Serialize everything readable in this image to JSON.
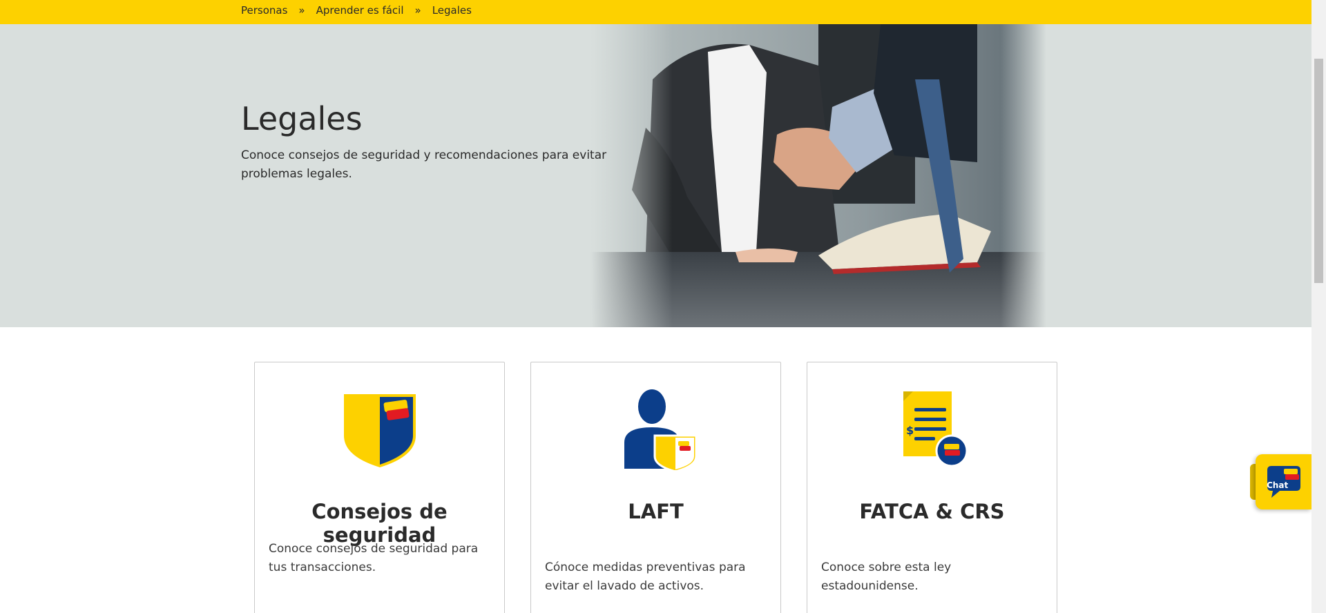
{
  "breadcrumb": {
    "items": [
      "Personas",
      "Aprender es fácil",
      "Legales"
    ],
    "separator": "»"
  },
  "hero": {
    "title": "Legales",
    "description": "Conoce consejos de seguridad y recomendaciones para evitar problemas legales."
  },
  "cards": [
    {
      "icon": "shield-icon",
      "title": "Consejos de seguridad",
      "description": "Conoce consejos de seguridad para tus transacciones."
    },
    {
      "icon": "person-shield-icon",
      "title": "LAFT",
      "description": "Cónoce medidas preventivas para evitar el lavado de activos."
    },
    {
      "icon": "document-dollar-icon",
      "title": "FATCA & CRS",
      "description": "Conoce sobre esta ley estadounidense."
    }
  ],
  "chat": {
    "label": "Chat",
    "icon": "chat-bubble-icon"
  },
  "colors": {
    "brand_yellow": "#FDD100",
    "brand_blue": "#0C3E8A",
    "brand_red": "#E21B22",
    "hero_bg": "#d9dfdd"
  }
}
